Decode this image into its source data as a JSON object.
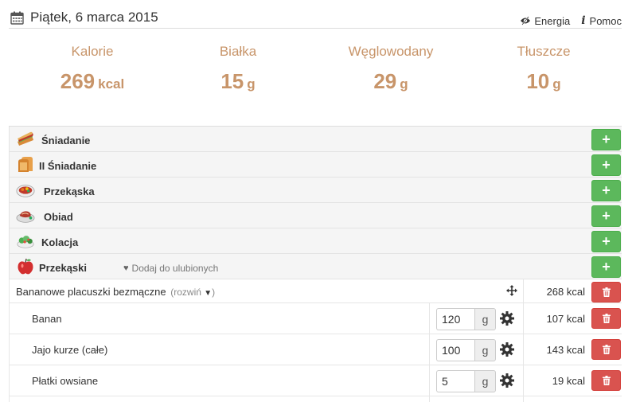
{
  "header": {
    "date": "Piątek, 6 marca 2015",
    "links": {
      "energy": "Energia",
      "help": "Pomoc"
    }
  },
  "summary": [
    {
      "label": "Kalorie",
      "value": "269",
      "unit": "kcal"
    },
    {
      "label": "Białka",
      "value": "15",
      "unit": "g"
    },
    {
      "label": "Węglowodany",
      "value": "29",
      "unit": "g"
    },
    {
      "label": "Tłuszcze",
      "value": "10",
      "unit": "g"
    }
  ],
  "meals": [
    {
      "name": "Śniadanie",
      "icon": "sandwich-icon"
    },
    {
      "name": "II Śniadanie",
      "icon": "toast-icon"
    },
    {
      "name": "Przekąska",
      "icon": "salad-bowl-icon"
    },
    {
      "name": "Obiad",
      "icon": "meat-plate-icon"
    },
    {
      "name": "Kolacja",
      "icon": "green-salad-icon"
    },
    {
      "name": "Przekąski",
      "icon": "apple-icon",
      "favorite_label": "Dodaj do ulubionych"
    }
  ],
  "add_button": "+",
  "dish": {
    "name": "Bananowe placuszki bezmączne",
    "expand_label": "(rozwiń",
    "kcal": "268 kcal",
    "ingredients": [
      {
        "name": "Banan",
        "qty": "120",
        "unit": "g",
        "kcal": "107 kcal"
      },
      {
        "name": "Jajo kurze (całe)",
        "qty": "100",
        "unit": "g",
        "kcal": "143 kcal"
      },
      {
        "name": "Płatki owsiane",
        "qty": "5",
        "unit": "g",
        "kcal": "19 kcal"
      }
    ]
  },
  "colors": {
    "accent": "#c8956a",
    "add": "#5cb85c",
    "delete": "#d9534f"
  }
}
